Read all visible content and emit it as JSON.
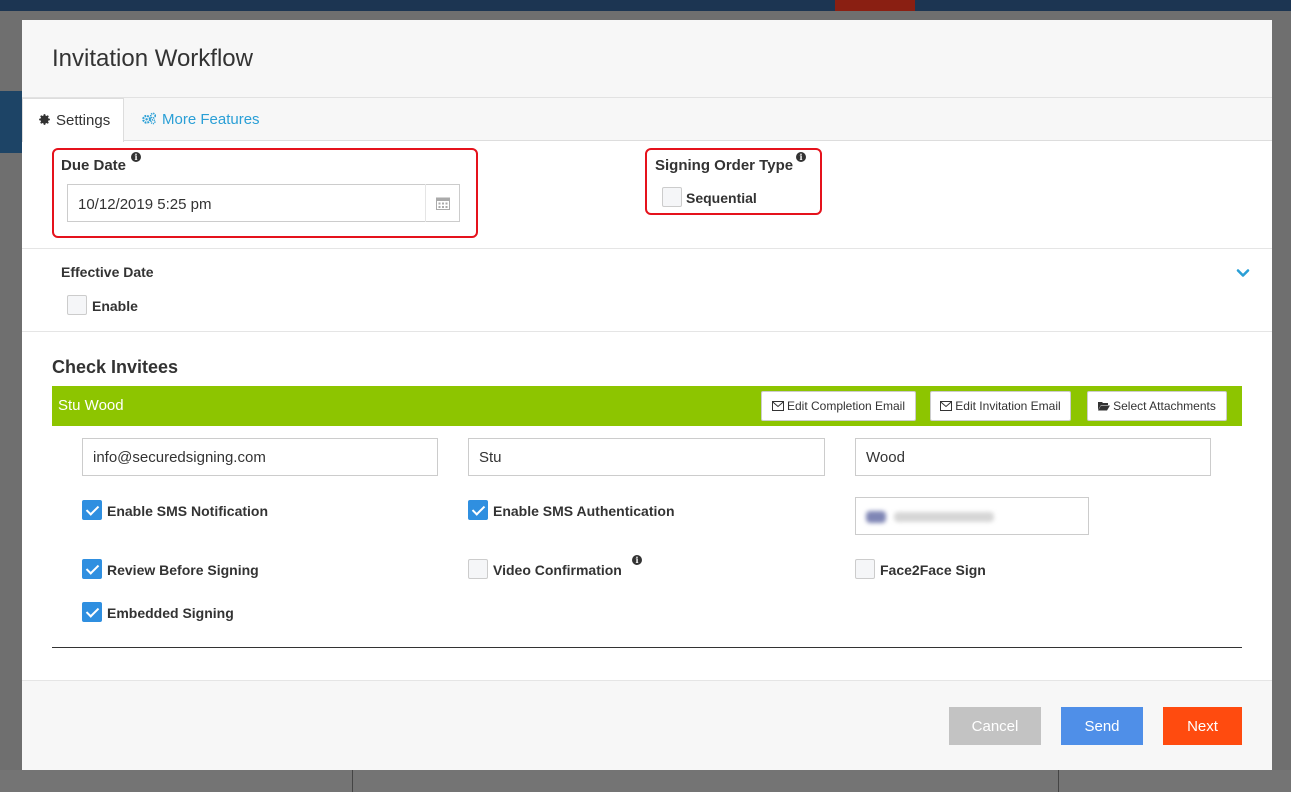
{
  "modal": {
    "title": "Invitation Workflow"
  },
  "tabs": [
    {
      "label": "Settings",
      "icon": "gear-icon"
    },
    {
      "label": "More Features",
      "icon": "gears-icon"
    }
  ],
  "due_date": {
    "label": "Due Date",
    "value": "10/12/2019 5:25 pm"
  },
  "signing_order": {
    "label": "Signing Order Type",
    "option_label": "Sequential",
    "checked": false
  },
  "effective_date": {
    "label": "Effective Date",
    "option_label": "Enable",
    "checked": false
  },
  "check_invitees": {
    "title": "Check Invitees",
    "invitee": {
      "name": "Stu Wood",
      "buttons": {
        "edit_completion": "Edit Completion Email",
        "edit_invitation": "Edit Invitation Email",
        "select_attachments": "Select Attachments"
      },
      "email": "info@securedsigning.com",
      "first_name": "Stu",
      "last_name": "Wood",
      "options": {
        "sms_notification": {
          "label": "Enable SMS Notification",
          "checked": true
        },
        "sms_authentication": {
          "label": "Enable SMS Authentication",
          "checked": true
        },
        "review_before_signing": {
          "label": "Review Before Signing",
          "checked": true
        },
        "video_confirmation": {
          "label": "Video Confirmation",
          "checked": false
        },
        "face2face_sign": {
          "label": "Face2Face Sign",
          "checked": false
        },
        "embedded_signing": {
          "label": "Embedded Signing",
          "checked": true
        }
      }
    }
  },
  "footer": {
    "cancel": "Cancel",
    "send": "Send",
    "next": "Next"
  },
  "colors": {
    "accent_blue": "#2a9fd6",
    "invitee_bar": "#8dc500",
    "next": "#ff4b0f",
    "send": "#4f8fe8",
    "highlight": "#e5121c"
  }
}
